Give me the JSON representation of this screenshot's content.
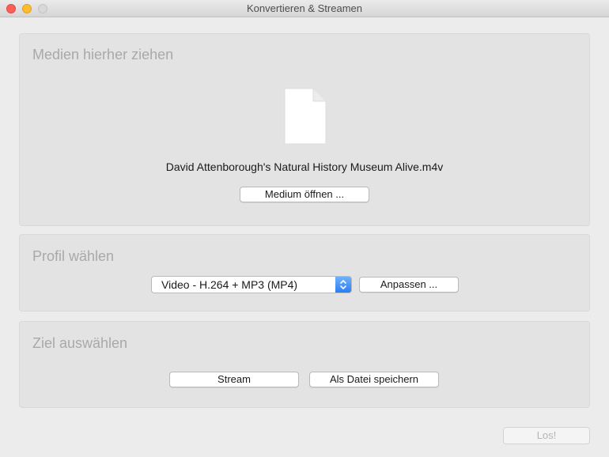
{
  "window": {
    "title": "Konvertieren & Streamen"
  },
  "media_panel": {
    "title": "Medien hierher ziehen",
    "file_icon": "document-icon",
    "filename": "David Attenborough's Natural History Museum Alive.m4v",
    "open_button": "Medium öffnen ..."
  },
  "profile_panel": {
    "title": "Profil wählen",
    "selected_profile": "Video - H.264 + MP3 (MP4)",
    "customize_button": "Anpassen ..."
  },
  "destination_panel": {
    "title": "Ziel auswählen",
    "stream_button": "Stream",
    "save_file_button": "Als Datei speichern"
  },
  "footer": {
    "go_button": "Los!"
  },
  "colors": {
    "close": "#fc5f57",
    "minimize": "#fdbc2e",
    "zoom_inactive": "#d8d8d8",
    "select_accent": "#2a7df6"
  }
}
